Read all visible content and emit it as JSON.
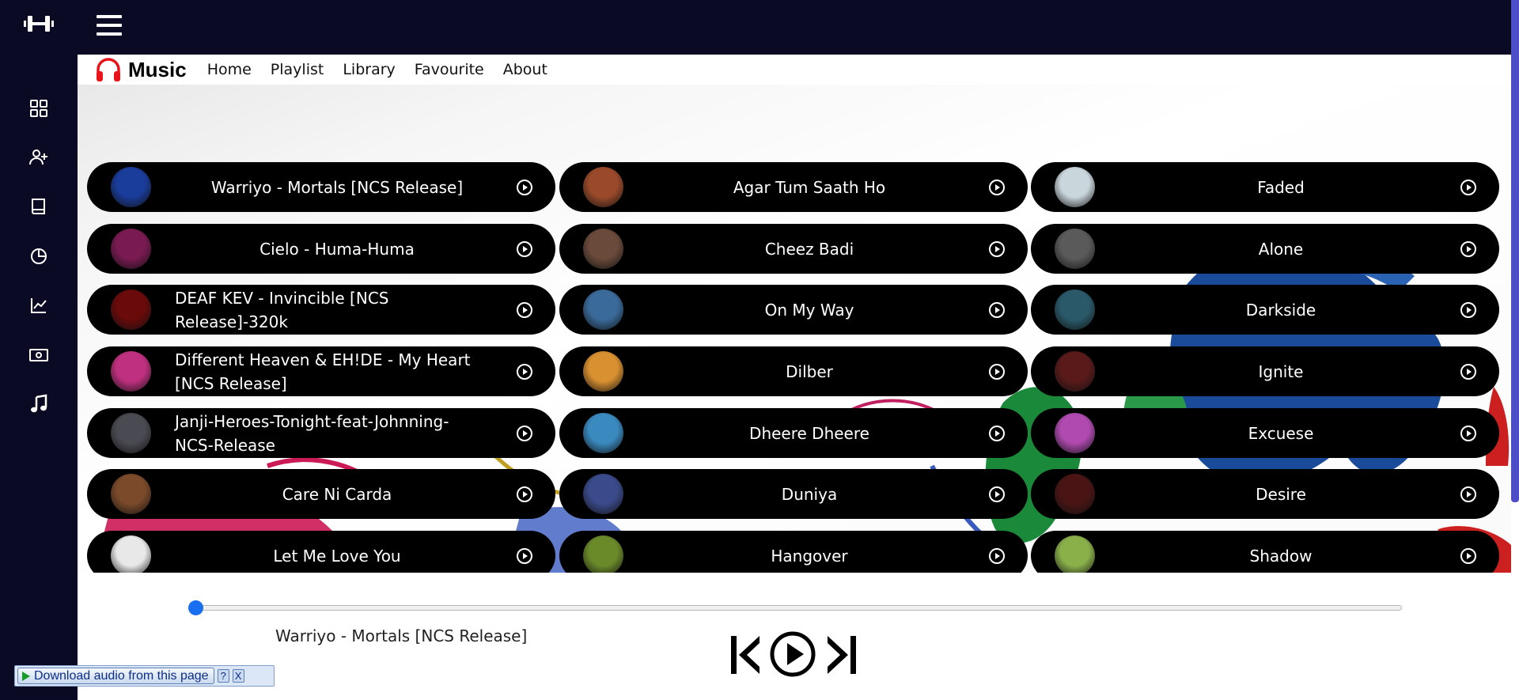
{
  "app": {
    "brand": "Music",
    "brand_color": "#e8131b",
    "accent": "#1a6ff0",
    "dark_bg": "#0b0a24"
  },
  "sidebar": {
    "items": [
      {
        "icon": "grid-icon"
      },
      {
        "icon": "add-user-icon"
      },
      {
        "icon": "book-icon"
      },
      {
        "icon": "pie-chart-icon"
      },
      {
        "icon": "line-chart-icon"
      },
      {
        "icon": "money-icon"
      },
      {
        "icon": "music-note-icon"
      }
    ]
  },
  "nav": {
    "links": [
      "Home",
      "Playlist",
      "Library",
      "Favourite",
      "About"
    ]
  },
  "songs": [
    {
      "title": "Warriyo - Mortals [NCS Release]",
      "thumb": "#1a3c9a"
    },
    {
      "title": "Agar Tum Saath Ho",
      "thumb": "#9a4a2a"
    },
    {
      "title": "Faded",
      "thumb": "#c9d6dc"
    },
    {
      "title": "Cielo - Huma-Huma",
      "thumb": "#7a1a52"
    },
    {
      "title": "Cheez Badi",
      "thumb": "#6a4a3a"
    },
    {
      "title": "Alone",
      "thumb": "#5a5a5a"
    },
    {
      "title": "DEAF KEV - Invincible [NCS Release]-320k",
      "thumb": "#6a0a0a"
    },
    {
      "title": "On My Way",
      "thumb": "#3a6a9a"
    },
    {
      "title": "Darkside",
      "thumb": "#2a5a6a"
    },
    {
      "title": "Different Heaven & EH!DE - My Heart [NCS Release]",
      "thumb": "#c03080"
    },
    {
      "title": "Dilber",
      "thumb": "#d89030"
    },
    {
      "title": "Ignite",
      "thumb": "#5a1a1a"
    },
    {
      "title": "Janji-Heroes-Tonight-feat-Johnning-NCS-Release",
      "thumb": "#4a4a52"
    },
    {
      "title": "Dheere Dheere",
      "thumb": "#3a8ac0"
    },
    {
      "title": "Excuese",
      "thumb": "#b04ab0"
    },
    {
      "title": "Care Ni Carda",
      "thumb": "#7a4a2a"
    },
    {
      "title": "Duniya",
      "thumb": "#3a4a8a"
    },
    {
      "title": "Desire",
      "thumb": "#4a1414"
    },
    {
      "title": "Let Me Love You",
      "thumb": "#e8e8e8"
    },
    {
      "title": "Hangover",
      "thumb": "#6a8a2a"
    },
    {
      "title": "Shadow",
      "thumb": "#8ab04a"
    }
  ],
  "player": {
    "now_playing": "Warriyo - Mortals [NCS Release]",
    "progress": 0
  },
  "download_bar": {
    "label": "Download audio from this page",
    "help": "?",
    "close": "X"
  }
}
